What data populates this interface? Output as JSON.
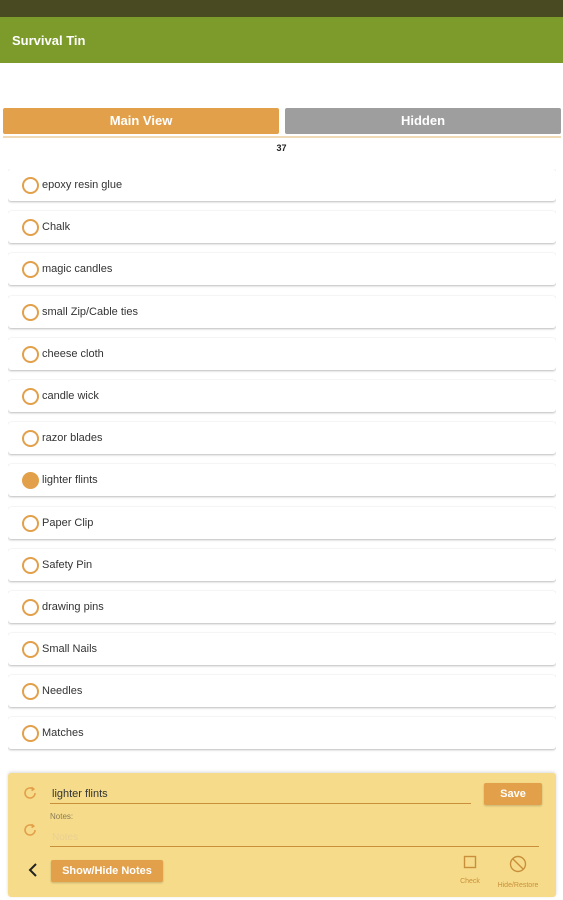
{
  "app": {
    "title": "Survival Tin"
  },
  "colors": {
    "accent": "#e3a04a",
    "app_bar": "#7c9b2a",
    "status_bar": "#4a4a22",
    "inactive_tab": "#9e9e9e",
    "panel": "#f6dc8a"
  },
  "tabs": [
    {
      "label": "Main View",
      "active": true
    },
    {
      "label": "Hidden",
      "active": false
    }
  ],
  "count": "37",
  "items": [
    {
      "label": "epoxy resin glue",
      "checked": false
    },
    {
      "label": "Chalk",
      "checked": false
    },
    {
      "label": "magic candles",
      "checked": false
    },
    {
      "label": "small Zip/Cable ties",
      "checked": false
    },
    {
      "label": "cheese cloth",
      "checked": false
    },
    {
      "label": "candle wick",
      "checked": false
    },
    {
      "label": "razor blades",
      "checked": false
    },
    {
      "label": "lighter flints",
      "checked": true
    },
    {
      "label": "Paper Clip",
      "checked": false
    },
    {
      "label": "Safety Pin",
      "checked": false
    },
    {
      "label": "drawing pins",
      "checked": false
    },
    {
      "label": "Small Nails",
      "checked": false
    },
    {
      "label": "Needles",
      "checked": false
    },
    {
      "label": "Matches",
      "checked": false
    }
  ],
  "editor": {
    "name_value": "lighter flints",
    "save_label": "Save",
    "notes_label": "Notes:",
    "notes_placeholder": "Notes",
    "show_hide_label": "Show/Hide Notes",
    "check_label": "Check",
    "hide_restore_label": "Hide/Restore"
  },
  "icons": {
    "refresh": "refresh-icon",
    "back": "chevron-left-icon",
    "check": "checkbox-outline-icon",
    "hide": "block-icon"
  }
}
